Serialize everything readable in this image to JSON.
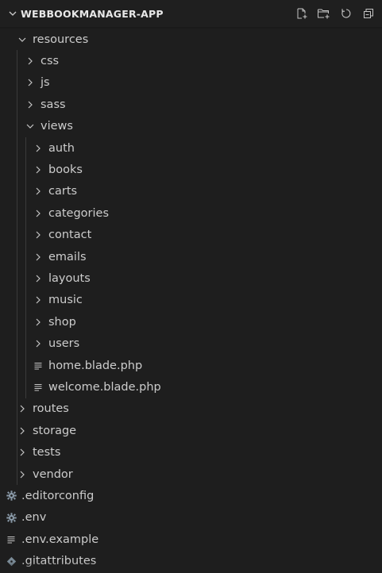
{
  "explorer": {
    "title": "WEBBOOKMANAGER-APP",
    "actions": [
      {
        "name": "new-file-icon"
      },
      {
        "name": "new-folder-icon"
      },
      {
        "name": "refresh-icon"
      },
      {
        "name": "collapse-all-icon"
      }
    ]
  },
  "tree": [
    {
      "label": "resources",
      "type": "folder",
      "expanded": true,
      "depth": 1
    },
    {
      "label": "css",
      "type": "folder",
      "expanded": false,
      "depth": 2
    },
    {
      "label": "js",
      "type": "folder",
      "expanded": false,
      "depth": 2
    },
    {
      "label": "sass",
      "type": "folder",
      "expanded": false,
      "depth": 2
    },
    {
      "label": "views",
      "type": "folder",
      "expanded": true,
      "depth": 2
    },
    {
      "label": "auth",
      "type": "folder",
      "expanded": false,
      "depth": 3
    },
    {
      "label": "books",
      "type": "folder",
      "expanded": false,
      "depth": 3
    },
    {
      "label": "carts",
      "type": "folder",
      "expanded": false,
      "depth": 3
    },
    {
      "label": "categories",
      "type": "folder",
      "expanded": false,
      "depth": 3
    },
    {
      "label": "contact",
      "type": "folder",
      "expanded": false,
      "depth": 3
    },
    {
      "label": "emails",
      "type": "folder",
      "expanded": false,
      "depth": 3
    },
    {
      "label": "layouts",
      "type": "folder",
      "expanded": false,
      "depth": 3
    },
    {
      "label": "music",
      "type": "folder",
      "expanded": false,
      "depth": 3
    },
    {
      "label": "shop",
      "type": "folder",
      "expanded": false,
      "depth": 3
    },
    {
      "label": "users",
      "type": "folder",
      "expanded": false,
      "depth": 3
    },
    {
      "label": "home.blade.php",
      "type": "file",
      "icon": "lines-file-icon",
      "depth": 3
    },
    {
      "label": "welcome.blade.php",
      "type": "file",
      "icon": "lines-file-icon",
      "depth": 3
    },
    {
      "label": "routes",
      "type": "folder",
      "expanded": false,
      "depth": 1
    },
    {
      "label": "storage",
      "type": "folder",
      "expanded": false,
      "depth": 1
    },
    {
      "label": "tests",
      "type": "folder",
      "expanded": false,
      "depth": 1
    },
    {
      "label": "vendor",
      "type": "folder",
      "expanded": false,
      "depth": 1
    },
    {
      "label": ".editorconfig",
      "type": "file",
      "icon": "gear-icon",
      "depth": 0
    },
    {
      "label": ".env",
      "type": "file",
      "icon": "gear-icon",
      "depth": 0
    },
    {
      "label": ".env.example",
      "type": "file",
      "icon": "lines-file-icon",
      "depth": 0
    },
    {
      "label": ".gitattributes",
      "type": "file",
      "icon": "git-icon",
      "depth": 0
    }
  ],
  "colors": {
    "background": "#1e1e1e",
    "text": "#cccccc",
    "icon": "#c5c5c5",
    "gear": "#8a9aa8",
    "git": "#7a8a96"
  }
}
